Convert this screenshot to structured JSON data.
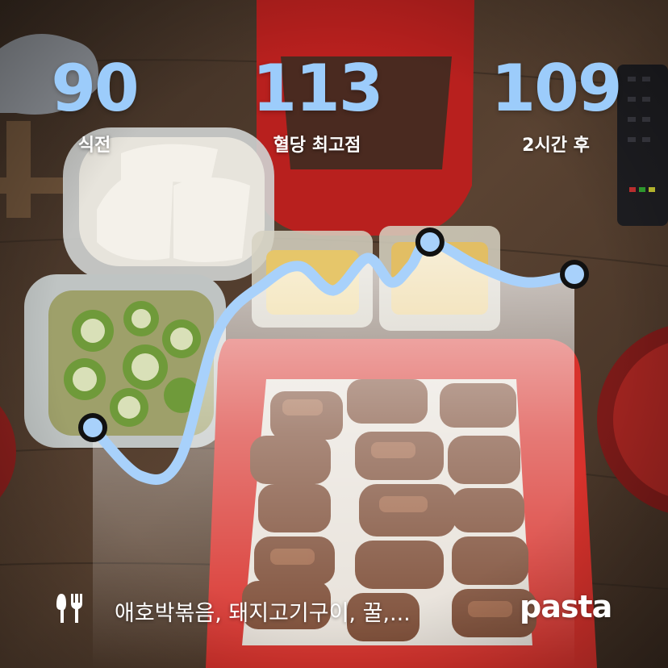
{
  "stats": {
    "before": {
      "value": "90",
      "label": "식전"
    },
    "peak": {
      "value": "113",
      "label": "혈당 최고점"
    },
    "after": {
      "value": "109",
      "label": "2시간 후"
    }
  },
  "curve": {
    "unit_note": "",
    "points": [
      {
        "t": 0,
        "v": 90
      },
      {
        "t": 0.1,
        "v": 84
      },
      {
        "t": 0.18,
        "v": 86
      },
      {
        "t": 0.26,
        "v": 102
      },
      {
        "t": 0.36,
        "v": 108
      },
      {
        "t": 0.43,
        "v": 110
      },
      {
        "t": 0.5,
        "v": 107
      },
      {
        "t": 0.57,
        "v": 111
      },
      {
        "t": 0.62,
        "v": 108
      },
      {
        "t": 0.66,
        "v": 110
      },
      {
        "t": 0.7,
        "v": 113
      },
      {
        "t": 0.8,
        "v": 110
      },
      {
        "t": 0.9,
        "v": 108
      },
      {
        "t": 1.0,
        "v": 109
      }
    ],
    "markers": [
      "before",
      "peak",
      "after"
    ],
    "line_color": "#a8d1fb",
    "marker_fill": "#a8d1fb",
    "marker_stroke": "#111111"
  },
  "footer": {
    "food_icon": "fork-knife-icon",
    "foods": "애호박볶음, 돼지고기구이, 꿀,...",
    "brand": "pasta"
  },
  "colors": {
    "accent": "#9cccfb",
    "plate": "#d8322c",
    "table": "#4a3628"
  }
}
